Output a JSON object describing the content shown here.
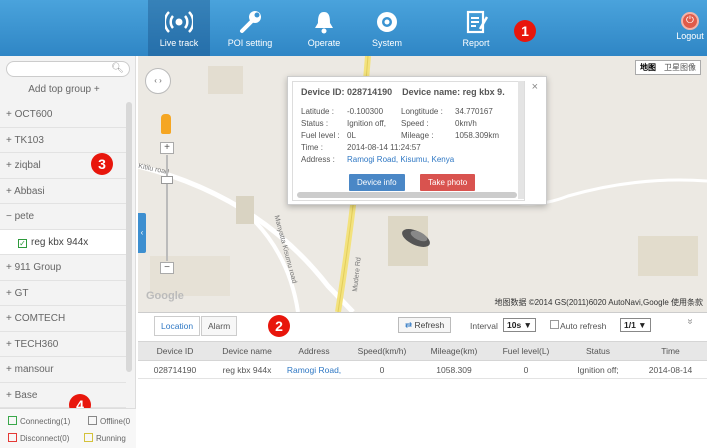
{
  "nav": {
    "items": [
      {
        "label": "Live track",
        "icon": "broadcast-icon"
      },
      {
        "label": "POI setting",
        "icon": "wrench-icon"
      },
      {
        "label": "Operate",
        "icon": "bell-icon"
      },
      {
        "label": "System",
        "icon": "gear-icon"
      },
      {
        "label": "Report",
        "icon": "report-icon"
      }
    ],
    "logout_label": "Logout"
  },
  "markers": {
    "one": "1",
    "two": "2",
    "three": "3",
    "four": "4"
  },
  "sidebar": {
    "search_placeholder": "",
    "add_group_label": "Add top group",
    "add_group_symbol": "+",
    "groups": [
      {
        "label": "+ OCT600"
      },
      {
        "label": "+ TK103"
      },
      {
        "label": "+ ziqbal"
      },
      {
        "label": "+ Abbasi"
      },
      {
        "label": "− pete"
      },
      {
        "label": "reg kbx 944x"
      },
      {
        "label": "+ 911 Group"
      },
      {
        "label": "+ GT"
      },
      {
        "label": "+ COMTECH"
      },
      {
        "label": "+ TECH360"
      },
      {
        "label": "+ mansour"
      },
      {
        "label": "+ Base"
      }
    ],
    "legend": {
      "connecting": "Connecting(1)",
      "offline": "Offline(0",
      "disconnect": "Disconnect(0)",
      "running": "Running",
      "colors": {
        "connecting": "#3aa84a",
        "offline": "#888888",
        "disconnect": "#e53935",
        "running": "#d4c23a"
      }
    }
  },
  "map": {
    "type_map": "地图",
    "type_satellite": "卫星图像",
    "google_logo": "Google",
    "copyright": "地图数据 ©2014 GS(2011)6020 AutoNavi,Google  使用条款",
    "roads": [
      "Kitilu road",
      "Manyatta Kisumu road",
      "Mudere Rd"
    ]
  },
  "popup": {
    "device_id_label": "Device ID:",
    "device_id": "028714190",
    "device_name_label": "Device name:",
    "device_name": "reg kbx 9.",
    "latitude_label": "Latitude :",
    "latitude": "-0.100300",
    "longitude_label": "Longtitude :",
    "longitude": "34.770167",
    "status_label": "Status :",
    "status": "Ignition off,",
    "speed_label": "Speed :",
    "speed": "0km/h",
    "fuel_label": "Fuel level :",
    "fuel": "0L",
    "mileage_label": "Mileage :",
    "mileage": "1058.309km",
    "time_label": "Time :",
    "time": "2014-08-14 11:24:57",
    "address_label": "Address :",
    "address": "Ramogi Road, Kisumu, Kenya",
    "device_info_button": "Device info",
    "take_photo_button": "Take photo",
    "close": "×"
  },
  "panel": {
    "tabs": [
      "Location",
      "Alarm"
    ],
    "refresh_label": "Refresh",
    "interval_label": "Interval",
    "interval_value": "10s ▼",
    "auto_refresh_label": "Auto refresh",
    "page_value": "1/1 ▼",
    "more": "»",
    "columns": [
      "Device ID",
      "Device name",
      "Address",
      "Speed(km/h)",
      "Mileage(km)",
      "Fuel level(L)",
      "Status",
      "Time"
    ],
    "rows": [
      [
        "028714190",
        "reg kbx 944x",
        "Ramogi Road,",
        "0",
        "1058.309",
        "0",
        "Ignition off;",
        "2014-08-14"
      ]
    ]
  }
}
